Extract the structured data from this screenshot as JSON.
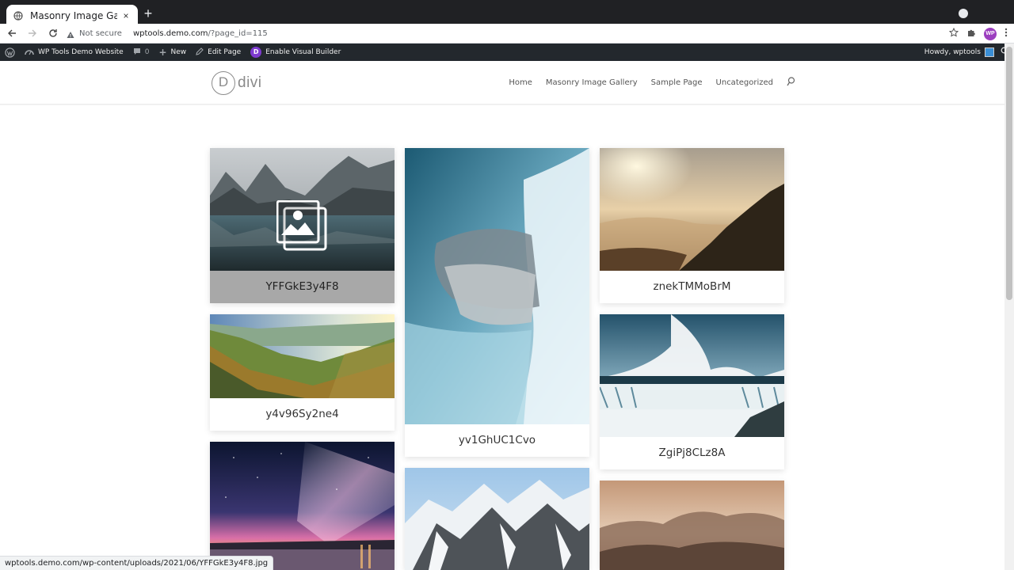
{
  "browser": {
    "tab_title": "Masonry Image Gallery",
    "tab_close": "×",
    "new_tab": "+",
    "security_label": "Not secure",
    "url_host": "wptools.demo.com",
    "url_path": "/?page_id=115",
    "profile_badge": "WP"
  },
  "adminbar": {
    "site_name": "WP Tools Demo Website",
    "comments_count": "0",
    "new_label": "New",
    "edit_label": "Edit Page",
    "divi_badge": "D",
    "visual_builder_label": "Enable Visual Builder",
    "howdy": "Howdy, wptools"
  },
  "site": {
    "logo_letter": "D",
    "logo_word": "divi",
    "nav": [
      "Home",
      "Masonry Image Gallery",
      "Sample Page",
      "Uncategorized"
    ]
  },
  "gallery": [
    {
      "caption": "YFFGkE3y4F8",
      "scene": "mountain-lake"
    },
    {
      "caption": "y4v96Sy2ne4",
      "scene": "green-valley"
    },
    {
      "caption": "",
      "scene": "milky-way"
    },
    {
      "caption": "yv1GhUC1Cvo",
      "scene": "waterfall-closeup"
    },
    {
      "caption": "",
      "scene": "snowy-peaks"
    },
    {
      "caption": "znekTMMoBrM",
      "scene": "foggy-sunset"
    },
    {
      "caption": "ZgiPj8CLz8A",
      "scene": "niagara-falls"
    },
    {
      "caption": "",
      "scene": "misty-hills"
    }
  ],
  "status_url": "wptools.demo.com/wp-content/uploads/2021/06/YFFGkE3y4F8.jpg",
  "colors": {
    "adminbar_bg": "#23282d",
    "tabstrip_bg": "#202124",
    "hover_caption_bg": "#a8a8a8"
  }
}
